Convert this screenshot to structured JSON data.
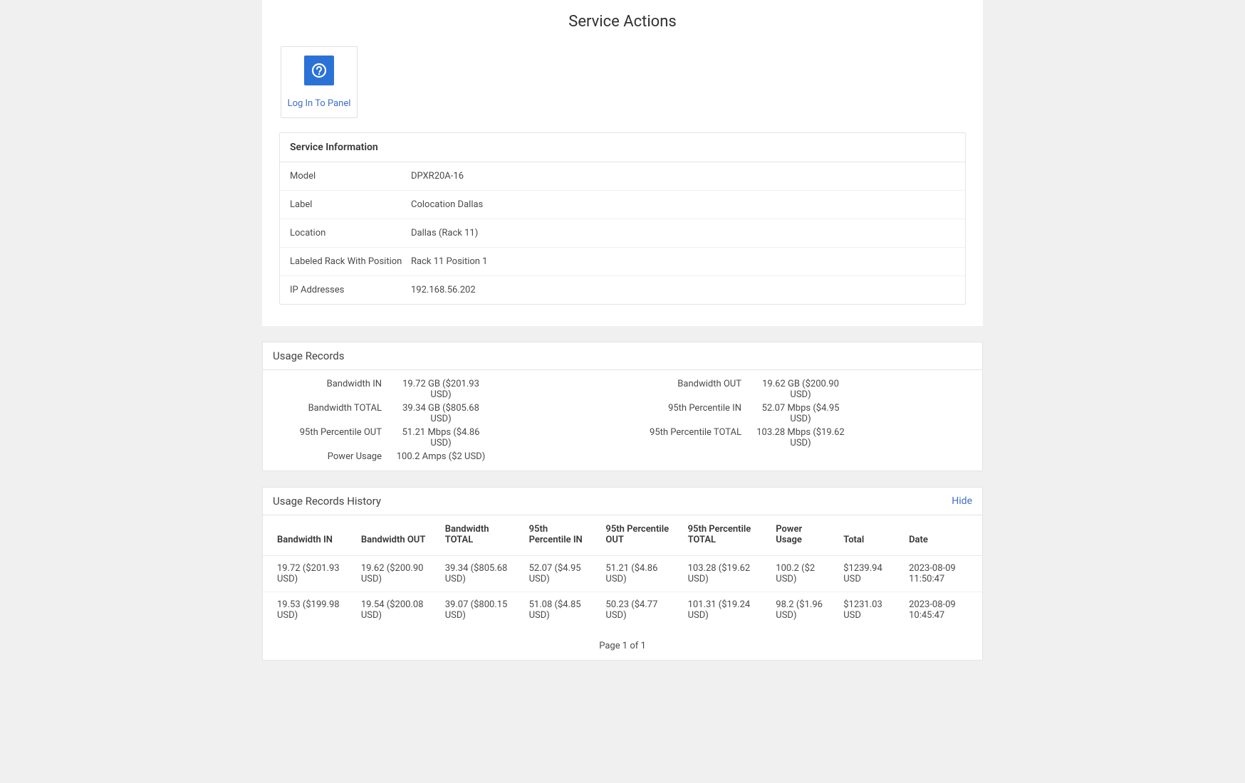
{
  "service_actions": {
    "title": "Service Actions",
    "login_tile_label": "Log In To Panel"
  },
  "service_info": {
    "header": "Service Information",
    "fields": [
      {
        "label": "Model",
        "value": "DPXR20A-16"
      },
      {
        "label": "Label",
        "value": "Colocation Dallas"
      },
      {
        "label": "Location",
        "value": "Dallas (Rack 11)"
      },
      {
        "label": "Labeled Rack With Position",
        "value": "Rack 11 Position 1"
      },
      {
        "label": "IP Addresses",
        "value": "192.168.56.202"
      }
    ]
  },
  "usage_records": {
    "header": "Usage Records",
    "left": [
      {
        "label": "Bandwidth IN",
        "value": "19.72 GB ($201.93 USD)"
      },
      {
        "label": "Bandwidth TOTAL",
        "value": "39.34 GB ($805.68 USD)"
      },
      {
        "label": "95th Percentile OUT",
        "value": "51.21 Mbps ($4.86 USD)"
      },
      {
        "label": "Power Usage",
        "value": "100.2 Amps ($2 USD)"
      }
    ],
    "right": [
      {
        "label": "Bandwidth OUT",
        "value": "19.62 GB ($200.90 USD)"
      },
      {
        "label": "95th Percentile IN",
        "value": "52.07 Mbps ($4.95 USD)"
      },
      {
        "label": "95th Percentile TOTAL",
        "value": "103.28 Mbps ($19.62 USD)"
      }
    ]
  },
  "history": {
    "header": "Usage Records History",
    "hide_label": "Hide",
    "columns": [
      "Bandwidth IN",
      "Bandwidth OUT",
      "Bandwidth TOTAL",
      "95th Percentile IN",
      "95th Percentile OUT",
      "95th Percentile TOTAL",
      "Power Usage",
      "Total",
      "Date"
    ],
    "rows": [
      [
        "19.72 ($201.93 USD)",
        "19.62 ($200.90 USD)",
        "39.34 ($805.68 USD)",
        "52.07 ($4.95 USD)",
        "51.21 ($4.86 USD)",
        "103.28 ($19.62 USD)",
        "100.2 ($2 USD)",
        "$1239.94 USD",
        "2023-08-09 11:50:47"
      ],
      [
        "19.53 ($199.98 USD)",
        "19.54 ($200.08 USD)",
        "39.07 ($800.15 USD)",
        "51.08 ($4.85 USD)",
        "50.23 ($4.77 USD)",
        "101.31 ($19.24 USD)",
        "98.2 ($1.96 USD)",
        "$1231.03 USD",
        "2023-08-09 10:45:47"
      ]
    ],
    "pagination": "Page 1 of 1"
  }
}
